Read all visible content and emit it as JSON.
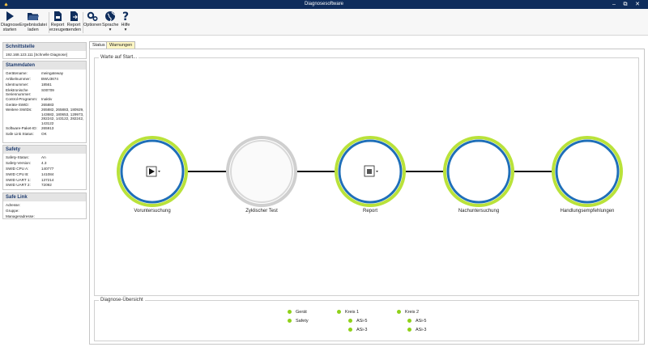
{
  "window": {
    "title": "Diagnosesoftware",
    "controls": [
      "–",
      "⧉",
      "✕"
    ]
  },
  "toolbar": {
    "buttons": [
      {
        "id": "diagnose",
        "icon": "play-icon",
        "label_line1": "Diagnose",
        "label_line2": "starten"
      },
      {
        "id": "load",
        "icon": "folder-open-icon",
        "label_line1": "Ergebnisdatei",
        "label_line2": "laden"
      },
      {
        "id": "report_create",
        "icon": "report-pdf-icon",
        "label_line1": "Report",
        "label_line2": "erzeugen"
      },
      {
        "id": "report_send",
        "icon": "report-send-icon",
        "label_line1": "Report",
        "label_line2": "senden"
      },
      {
        "id": "options",
        "icon": "gears-icon",
        "label_line1": "Optionen",
        "label_line2": ""
      },
      {
        "id": "language",
        "icon": "globe-icon",
        "label_line1": "Sprache",
        "label_line2": "▾"
      },
      {
        "id": "help",
        "icon": "help-icon",
        "label_line1": "Hilfe",
        "label_line2": "▾"
      }
    ]
  },
  "left": {
    "schnittstelle": {
      "title": "Schnittstelle",
      "value": "192.168.123.111 [Schnelle Diagnose]"
    },
    "stammdaten": {
      "title": "Stammdaten",
      "rows": [
        {
          "k": "Gerätename:",
          "v": "meingateway"
        },
        {
          "k": "Artikelnummer:",
          "v": "BWU3674"
        },
        {
          "k": "Identnummer:",
          "v": "18561"
        },
        {
          "k": "Elektronische",
          "v": "S00709"
        },
        {
          "k": "Seriennummer:",
          "v": ""
        },
        {
          "k": "Control-Programm:",
          "v": "Inaktiv"
        },
        {
          "k": "Geräte-SWID:",
          "v": "265883"
        }
      ],
      "weitere_label": "Weitere SWIDs:",
      "weitere_lines": [
        "265882, 265883, 180929,",
        "143682, 180653, 129973,",
        "282242, 143122, 282242,",
        "143122"
      ],
      "rows2": [
        {
          "k": "Software-Paket-ID:",
          "v": "265913"
        },
        {
          "k": "Safe Link Status:",
          "v": "OK"
        }
      ]
    },
    "safety": {
      "title": "Safety",
      "rows": [
        {
          "k": "Safety-Status:",
          "v": "An"
        },
        {
          "k": "Safety-Version:",
          "v": "4.3"
        },
        {
          "k": "SWID CPU A:",
          "v": "140777"
        },
        {
          "k": "SWID CPU B:",
          "v": "141084"
        },
        {
          "k": "SWID UART 1:",
          "v": "137214"
        },
        {
          "k": "SWID UART 2:",
          "v": "72092"
        }
      ]
    },
    "safelink": {
      "title": "Safe Link",
      "rows": [
        {
          "k": "Adresse:",
          "v": ""
        },
        {
          "k": "Gruppe:",
          "v": ""
        },
        {
          "k": "Manageradresse:",
          "v": ""
        }
      ]
    }
  },
  "tabs": [
    {
      "label": "Status",
      "active": true
    },
    {
      "label": "Warnungen",
      "active": false
    }
  ],
  "main": {
    "wait_title": "Warte auf Start...",
    "steps": [
      {
        "label": "Voruntersuchung",
        "state": "active",
        "icon": "play-icon"
      },
      {
        "label": "Zyklischer Test",
        "state": "disabled",
        "icon": ""
      },
      {
        "label": "Report",
        "state": "active",
        "icon": "report-icon"
      },
      {
        "label": "Nachuntersuchung",
        "state": "active",
        "icon": ""
      },
      {
        "label": "Handlungsempfehlungen",
        "state": "active",
        "icon": ""
      }
    ],
    "overview": {
      "title": "Diagnose-Übersicht",
      "col1": [
        "Gerät",
        "Safety"
      ],
      "col2_head": "Kreis 1",
      "col2": [
        "ASi-5",
        "ASi-3"
      ],
      "col3_head": "Kreis 2",
      "col3": [
        "ASi-5",
        "ASi-3"
      ]
    }
  },
  "colors": {
    "titlebar": "#0f2d5c",
    "ring_blue": "#1f6fb8",
    "ring_green": "#b9e23a",
    "ring_gray": "#c8c8c8",
    "status_green": "#8fd11a"
  }
}
